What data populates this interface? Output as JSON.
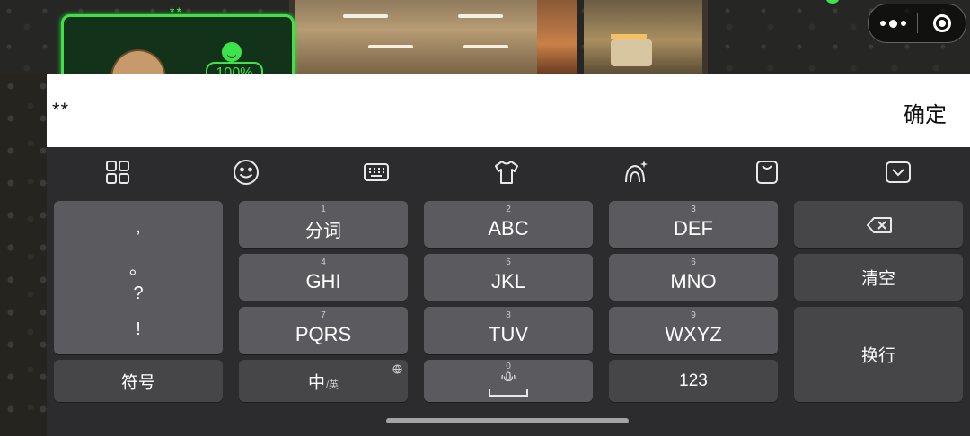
{
  "game": {
    "dweller_stars": "**",
    "dweller_happiness": "100%"
  },
  "input_bar": {
    "value": "**",
    "confirm_label": "确定"
  },
  "toolbar": {
    "icons": [
      "grid-icon",
      "emoji-icon",
      "keyboard-icon",
      "skin-icon",
      "ai-assistant-icon",
      "clipboard-icon",
      "hide-keyboard-icon"
    ]
  },
  "keyboard": {
    "punctuation": [
      ",",
      "。",
      "?",
      "!"
    ],
    "symbols_label": "符号",
    "keys": [
      {
        "num": "1",
        "label": "分词"
      },
      {
        "num": "2",
        "label": "ABC"
      },
      {
        "num": "3",
        "label": "DEF"
      },
      {
        "num": "4",
        "label": "GHI"
      },
      {
        "num": "5",
        "label": "JKL"
      },
      {
        "num": "6",
        "label": "MNO"
      },
      {
        "num": "7",
        "label": "PQRS"
      },
      {
        "num": "8",
        "label": "TUV"
      },
      {
        "num": "9",
        "label": "WXYZ"
      }
    ],
    "lang_main": "中",
    "lang_sub": "/英",
    "space_num": "0",
    "numbers_label": "123",
    "clear_label": "清空",
    "newline_label": "换行"
  },
  "colors": {
    "keyboard_bg": "#2c2c2e",
    "key": "#5b5b5f",
    "function_key": "#464649",
    "accent_green": "#41e04a"
  }
}
